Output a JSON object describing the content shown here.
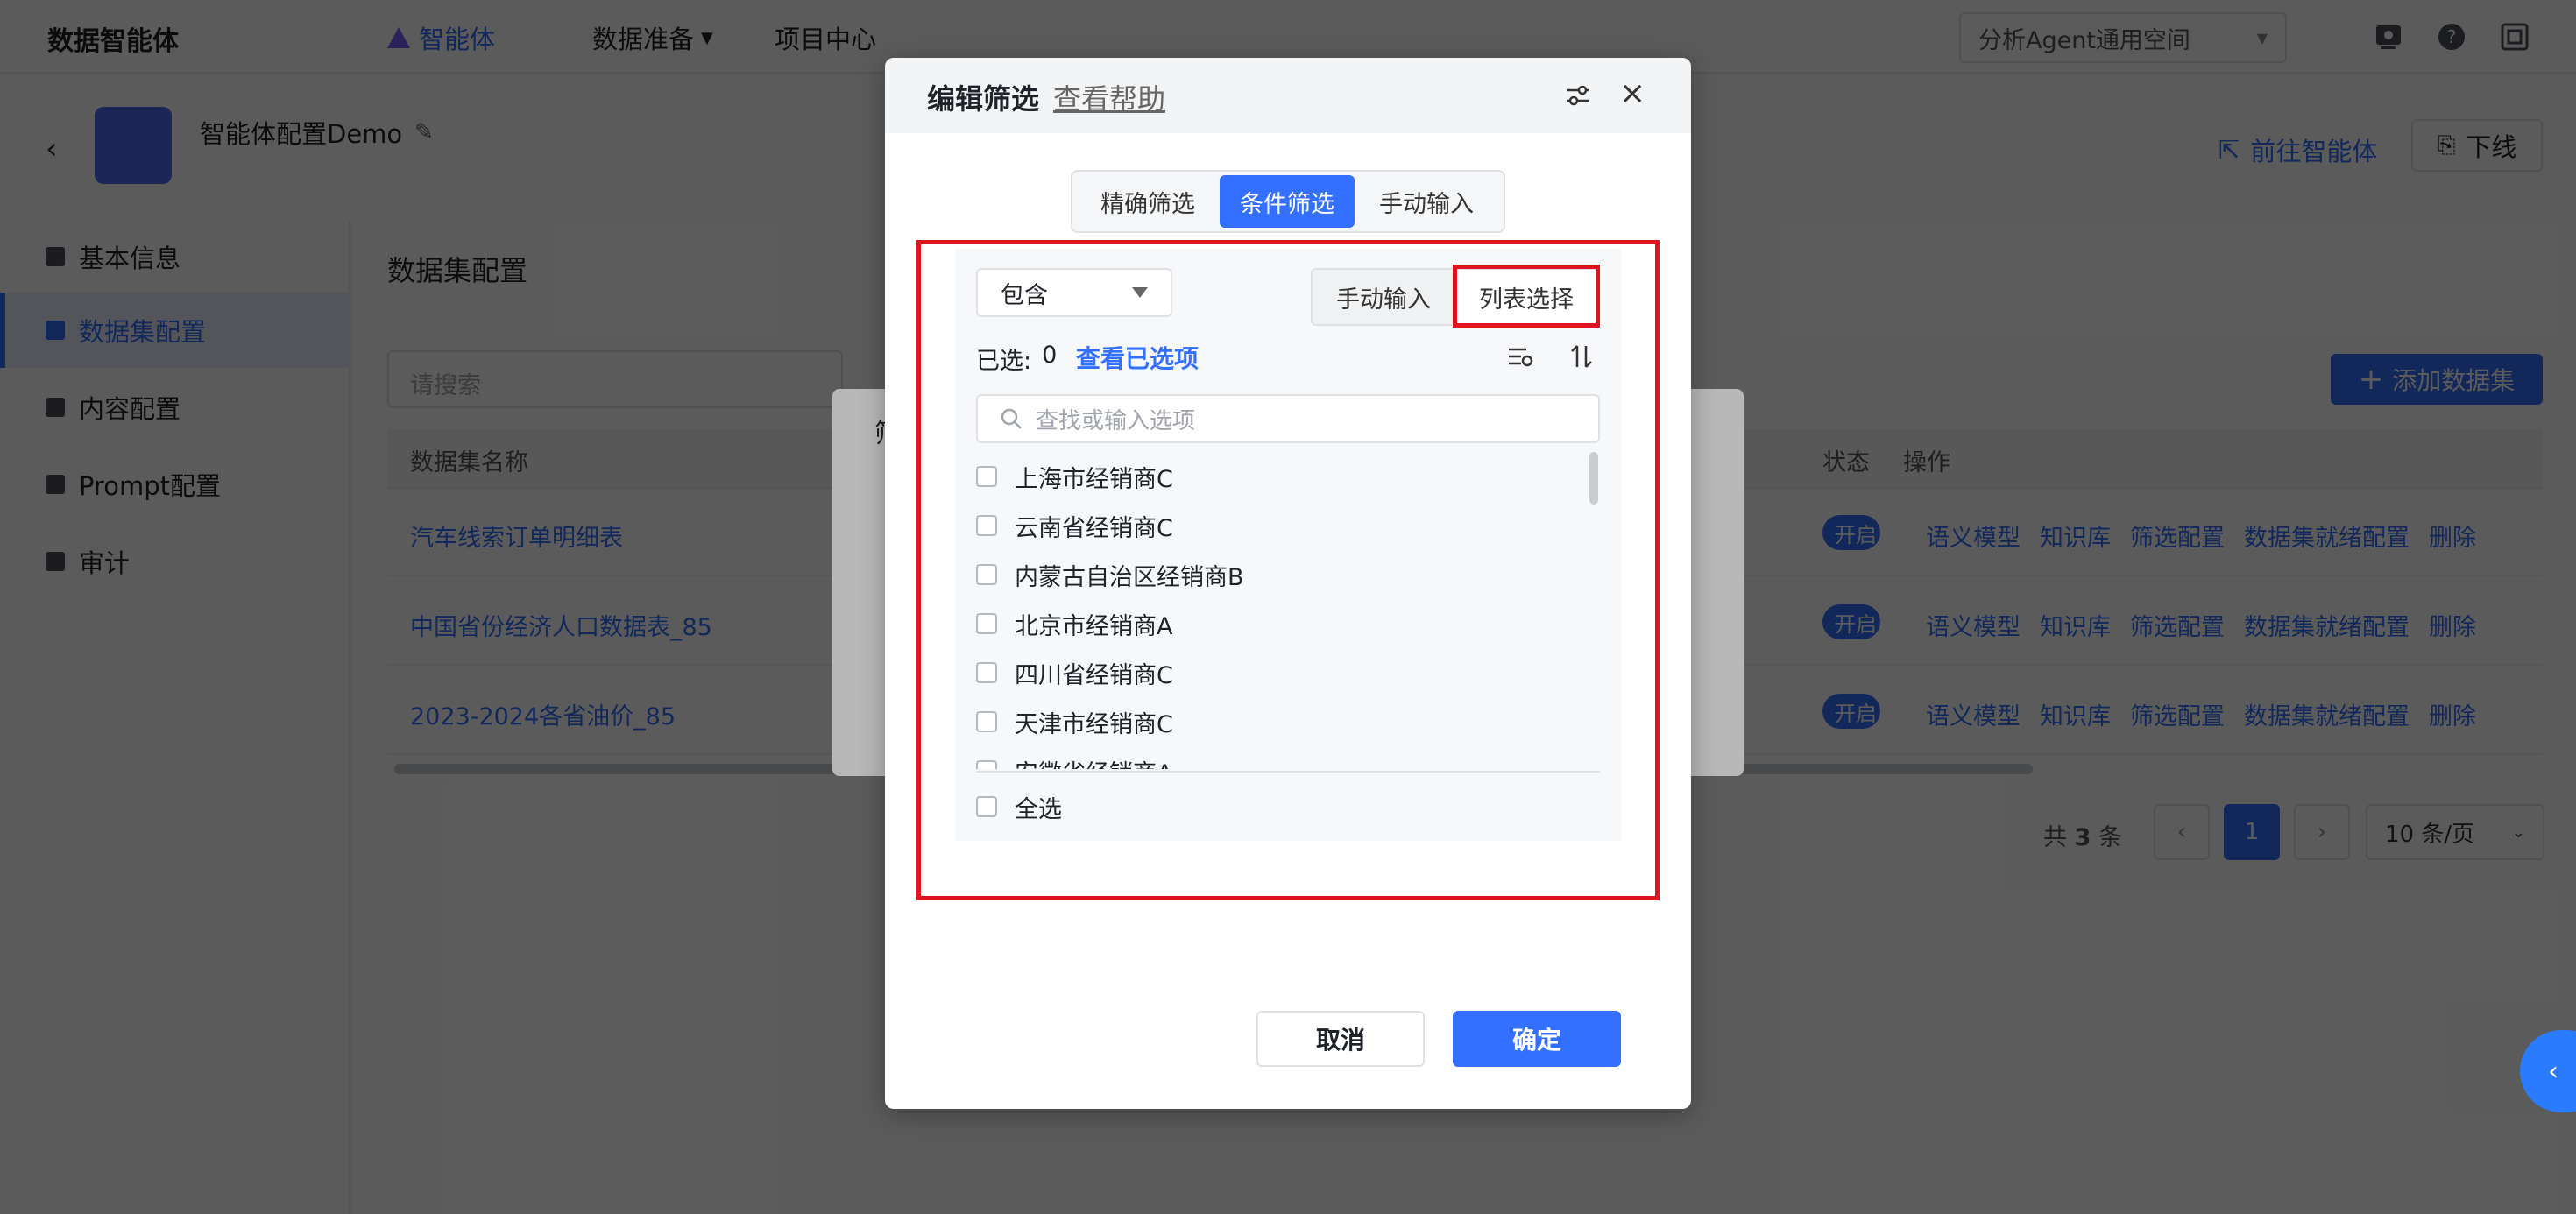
{
  "header": {
    "brand": "数据智能体",
    "nav": [
      {
        "label": "智能体",
        "active": true
      },
      {
        "label": "数据准备",
        "active": false
      },
      {
        "label": "项目中心",
        "active": false
      }
    ],
    "workspace": "分析Agent通用空间"
  },
  "subheader": {
    "agent_name": "智能体配置Demo",
    "goto_label": "前往智能体",
    "offline_label": "下线"
  },
  "sidebar": {
    "items": [
      {
        "label": "基本信息"
      },
      {
        "label": "数据集配置"
      },
      {
        "label": "内容配置"
      },
      {
        "label": "Prompt配置"
      },
      {
        "label": "审计"
      }
    ]
  },
  "main": {
    "title": "数据集配置",
    "search_placeholder": "请搜索",
    "add_label": "添加数据集",
    "columns": {
      "name": "数据集名称",
      "status": "状态",
      "ops": "操作"
    },
    "rows": [
      {
        "name": "汽车线索订单明细表",
        "status": "开启"
      },
      {
        "name": "中国省份经济人口数据表_85",
        "status": "开启"
      },
      {
        "name": "2023-2024各省油价_85",
        "status": "开启"
      }
    ],
    "ops": [
      "语义模型",
      "知识库",
      "筛选配置",
      "数据集就绪配置",
      "删除"
    ],
    "pager": {
      "total_prefix": "共",
      "total": "3",
      "total_suffix": "条",
      "current": "1",
      "size": "10 条/页"
    }
  },
  "under_dialog": {
    "title_fragment": "筛"
  },
  "dialog": {
    "title": "编辑筛选",
    "help": "查看帮助",
    "tabs": [
      {
        "label": "精确筛选",
        "active": false
      },
      {
        "label": "条件筛选",
        "active": true
      },
      {
        "label": "手动输入",
        "active": false
      }
    ],
    "operator": "包含",
    "modes": [
      {
        "label": "手动输入",
        "active": false
      },
      {
        "label": "列表选择",
        "active": true
      }
    ],
    "selected_label": "已选:",
    "selected_count": "0",
    "view_selected": "查看已选项",
    "option_search_placeholder": "查找或输入选项",
    "options": [
      "上海市经销商C",
      "云南省经销商C",
      "内蒙古自治区经销商B",
      "北京市经销商A",
      "四川省经销商C",
      "天津市经销商C",
      "安徽省经销商A"
    ],
    "select_all": "全选",
    "cancel": "取消",
    "ok": "确定"
  },
  "colors": {
    "accent": "#3370ff",
    "highlight": "#e0141e"
  }
}
